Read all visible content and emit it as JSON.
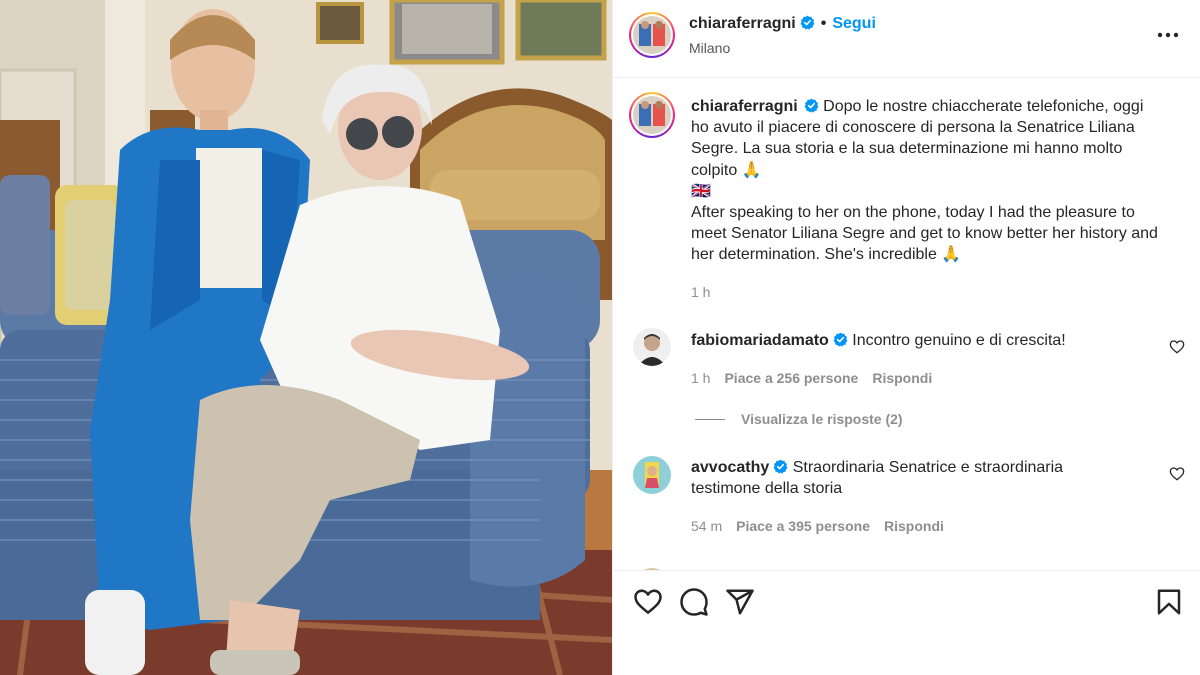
{
  "post": {
    "author": "chiaraferragni",
    "follow_label": "Segui",
    "separator": "•",
    "location": "Milano",
    "verified": true,
    "accent_color": "#0095f6"
  },
  "caption": {
    "username": "chiaraferragni",
    "italian": "Dopo le nostre chiaccherate telefoniche, oggi ho avuto il piacere di conoscere di persona la Senatrice Liliana Segre. La sua storia e la sua determinazione mi hanno molto colpito 🙏",
    "flag": "🇬🇧",
    "english": "After speaking to her on the phone, today I had the pleasure to meet Senator Liliana Segre and get to know better her history and her determination. She's incredible 🙏",
    "time": "1 h"
  },
  "comments": [
    {
      "username": "fabiomariadamato",
      "verified": true,
      "text": "Incontro genuino e di crescita!",
      "time": "1 h",
      "likes": "Piace a 256 persone",
      "reply": "Rispondi"
    },
    {
      "username": "avvocathy",
      "verified": true,
      "text": "Straordinaria Senatrice e straordinaria testimone della storia",
      "time": "54 m",
      "likes": "Piace a 395 persone",
      "reply": "Rispondi"
    }
  ],
  "view_replies": "Visualizza le risposte (2)",
  "icons": {
    "header_more": "more-horizontal-icon",
    "like": "heart-icon",
    "comment": "comment-bubble-icon",
    "share": "paper-plane-icon",
    "save": "bookmark-icon",
    "verified": "verified-badge-icon"
  }
}
